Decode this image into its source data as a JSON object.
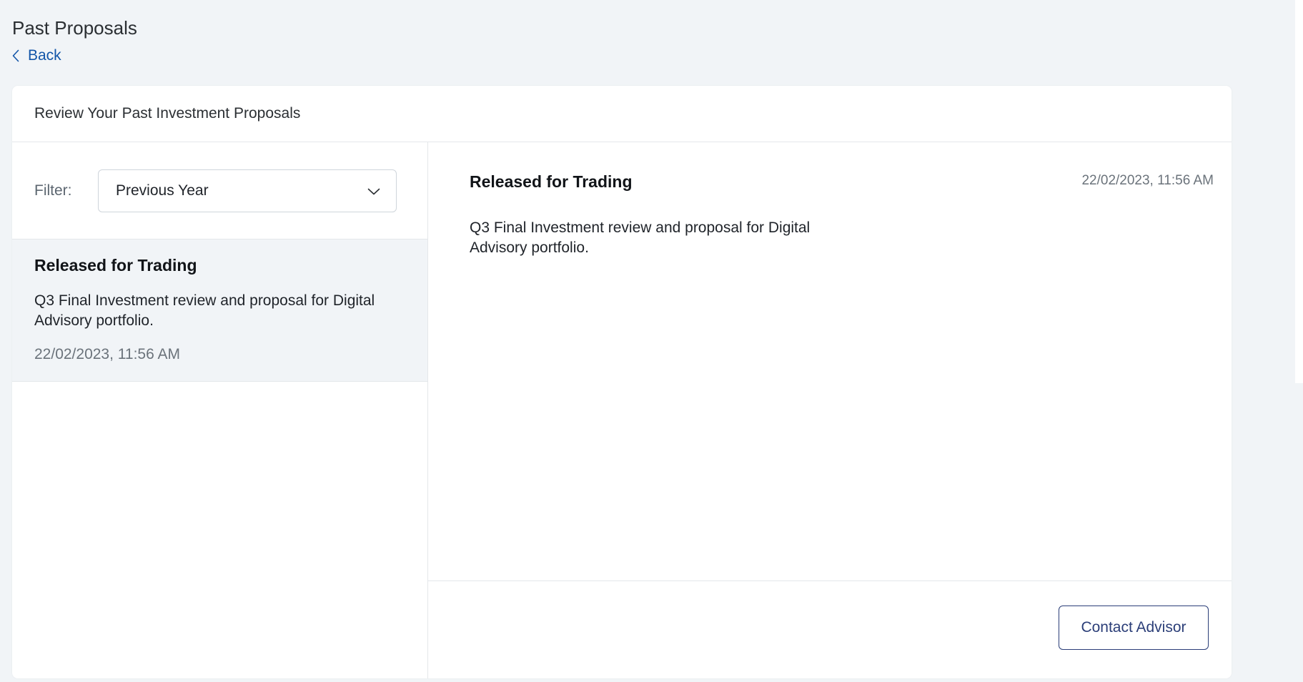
{
  "page": {
    "title": "Past Proposals",
    "back_label": "Back"
  },
  "card": {
    "header": "Review Your Past Investment Proposals"
  },
  "filter": {
    "label": "Filter:",
    "selected": "Previous Year"
  },
  "proposals": [
    {
      "status": "Released for Trading",
      "description": "Q3 Final Investment review and proposal for Digital Advisory portfolio.",
      "date": "22/02/2023, 11:56 AM"
    }
  ],
  "detail": {
    "status": "Released for Trading",
    "date": "22/02/2023, 11:56 AM",
    "description": "Q3 Final Investment review and proposal for Digital Advisory portfolio.",
    "contact_label": "Contact Advisor"
  },
  "icons": {
    "back": "chevron-left-icon",
    "dropdown": "chevron-down-icon"
  },
  "colors": {
    "accent": "#1255a8",
    "button_border": "#2b3e78",
    "page_bg": "#f1f4f7",
    "selected_bg": "#f1f4f7"
  }
}
